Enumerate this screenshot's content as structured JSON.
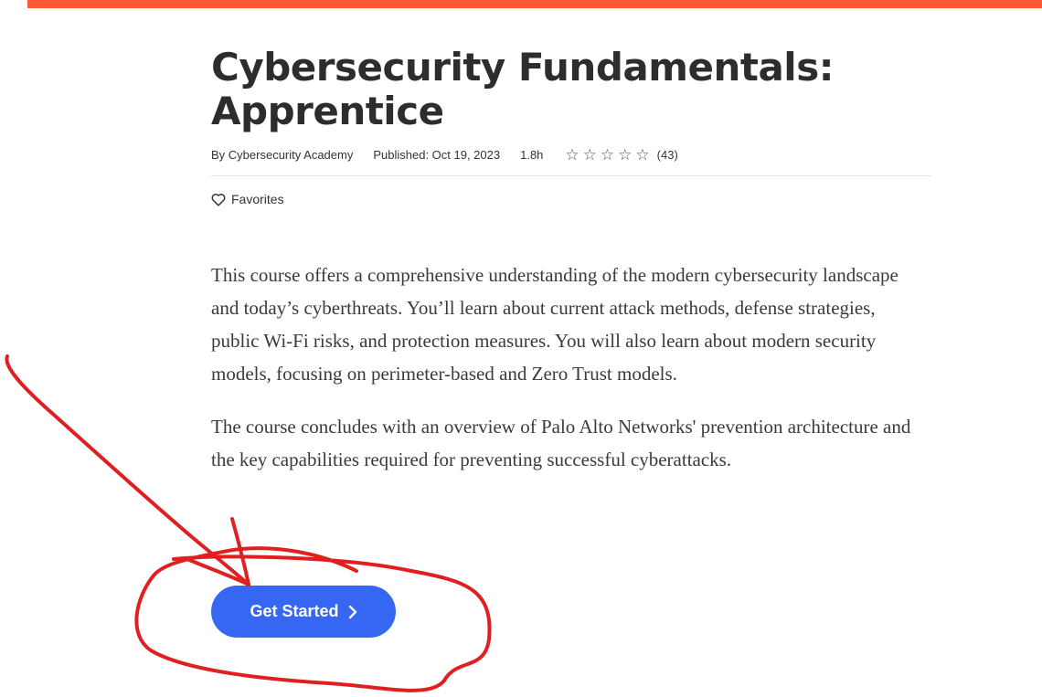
{
  "course": {
    "title_line1": "Cybersecurity Fundamentals:",
    "title_line2": "Apprentice",
    "author": "By Cybersecurity Academy",
    "published": "Published: Oct 19, 2023",
    "duration": "1.8h",
    "rating_count": "(43)",
    "rating_stars": 0
  },
  "actions": {
    "favorites_label": "Favorites",
    "get_started_label": "Get Started"
  },
  "description": {
    "paragraph1": "This course offers a comprehensive understanding of the modern cybersecurity landscape and today’s cyberthreats. You’ll learn about current attack methods, defense strategies, public Wi-Fi risks, and protection measures. You will also learn about modern security models, focusing on perimeter-based and Zero Trust models.",
    "paragraph2": "The course concludes with an overview of Palo Alto Networks' prevention architecture and the key capabilities required for preventing successful cyberattacks."
  },
  "colors": {
    "accent_bar": "#ff5a35",
    "button": "#3567f2",
    "annotation": "#e02020"
  },
  "icons": {
    "favorite": "heart-outline-icon",
    "star": "star-outline-icon",
    "button_arrow": "chevron-right-icon"
  }
}
